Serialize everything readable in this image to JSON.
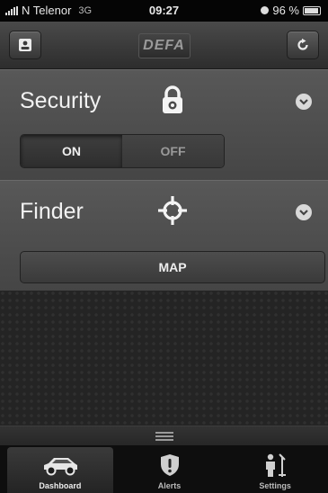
{
  "statusbar": {
    "carrier": "N Telenor",
    "network": "3G",
    "time": "09:27",
    "battery": "96 %"
  },
  "navbar": {
    "logo": "DEFA",
    "left_icon": "profile-card-icon",
    "right_icon": "refresh-icon"
  },
  "security": {
    "title": "Security",
    "icon": "lock-icon",
    "toggle_on": "ON",
    "toggle_off": "OFF",
    "selected": "ON"
  },
  "finder": {
    "title": "Finder",
    "icon": "crosshair-icon",
    "map_label": "MAP"
  },
  "tabs": [
    {
      "label": "Dashboard",
      "icon": "car-icon",
      "active": true
    },
    {
      "label": "Alerts",
      "icon": "shield-alert-icon",
      "active": false
    },
    {
      "label": "Settings",
      "icon": "settings-person-icon",
      "active": false
    }
  ],
  "colors": {
    "panel": "#4e4e4e",
    "tabbar": "#0e0e0e",
    "text": "#f2f2f2"
  }
}
